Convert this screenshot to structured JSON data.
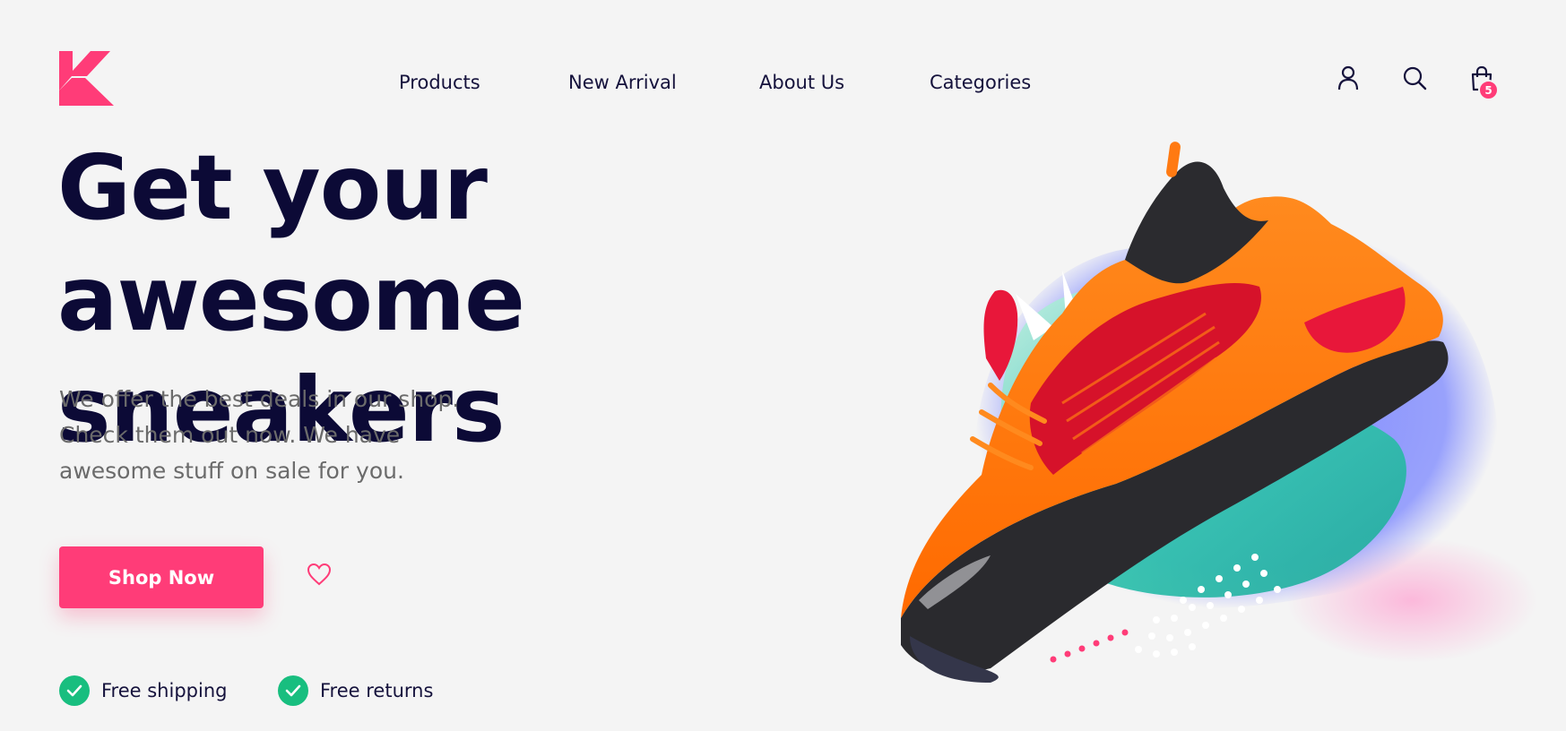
{
  "nav": {
    "items": [
      {
        "label": "Products"
      },
      {
        "label": "New Arrival"
      },
      {
        "label": "About Us"
      },
      {
        "label": "Categories"
      }
    ]
  },
  "header_icons": {
    "account": "user-icon",
    "search": "search-icon",
    "cart": "shopping-bag-icon",
    "cart_count": "5"
  },
  "hero": {
    "headline_line1": "Get your awesome",
    "headline_line2": "sneakers",
    "description": "We offer the best deals in our shop. Check them out now. We have awesome stuff on sale for you.",
    "cta_label": "Shop Now",
    "wishlist_icon": "heart-icon",
    "perks": [
      {
        "label": "Free shipping",
        "icon": "check-icon"
      },
      {
        "label": "Free returns",
        "icon": "check-icon"
      }
    ]
  },
  "colors": {
    "brand": "#ff3c78",
    "headline": "#0c0a36",
    "check": "#18be7f",
    "shoe_orange": "#ff7a12",
    "shoe_red": "#d6122a"
  }
}
